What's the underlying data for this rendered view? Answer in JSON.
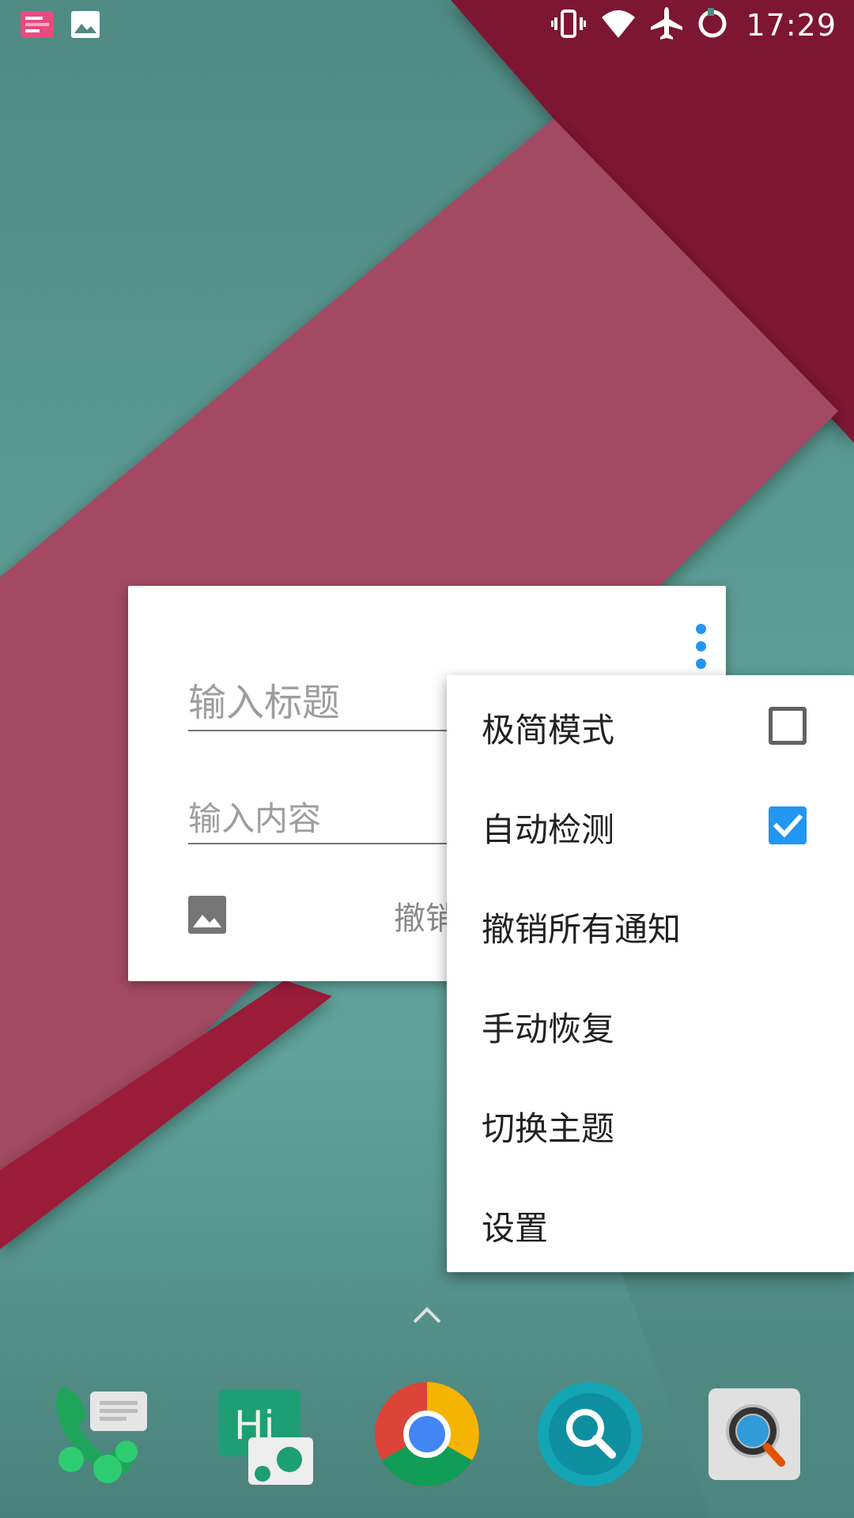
{
  "status_bar": {
    "time": "17:29",
    "left_icons": [
      "notes-notification-icon",
      "image-notification-icon"
    ],
    "right_icons": [
      "vibrate-icon",
      "wifi-icon",
      "airplane-mode-icon",
      "sync-icon"
    ]
  },
  "widget": {
    "title_placeholder": "输入标题",
    "content_placeholder": "输入内容",
    "undo_label_partial": "撤销",
    "accent_color": "#2196f3"
  },
  "menu": {
    "items": [
      {
        "label": "极简模式",
        "checkbox": "unchecked"
      },
      {
        "label": "自动检测",
        "checkbox": "checked"
      },
      {
        "label": "撤销所有通知"
      },
      {
        "label": "手动恢复"
      },
      {
        "label": "切换主题"
      },
      {
        "label": "设置"
      }
    ]
  },
  "dock": {
    "apps": [
      "phone-messages-icon",
      "hangouts-icon",
      "chrome-icon",
      "search-icon",
      "finder-icon"
    ]
  },
  "colors": {
    "wallpaper_teal": "#5d9e96",
    "wallpaper_crimson": "#8e1a34",
    "wallpaper_rose": "#a94d66",
    "checkbox_checked": "#2196f3"
  }
}
